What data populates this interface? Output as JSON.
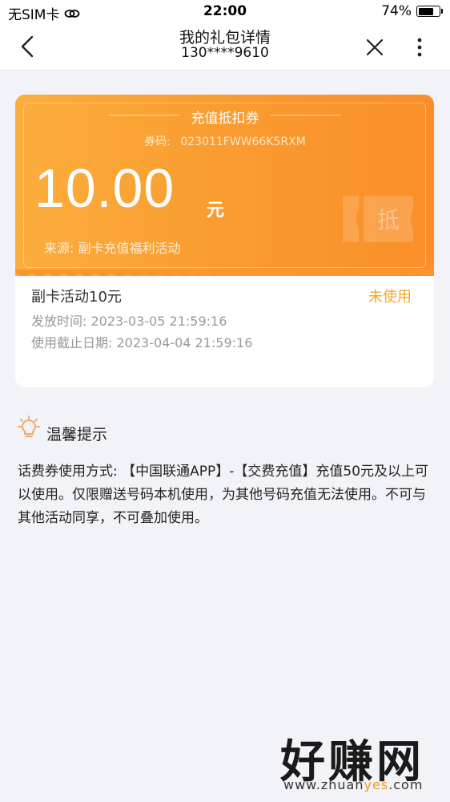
{
  "status_bar": {
    "carrier": "无SIM卡",
    "time": "22:00",
    "battery": "74%",
    "battery_level": 0.74
  },
  "nav": {
    "title": "我的礼包详情",
    "subtitle": "130****9610"
  },
  "coupon": {
    "title": "充值抵扣券",
    "code_label": "券码:",
    "code": "023011FWW66K5RXM",
    "amount": "10.00",
    "unit": "元",
    "source": "来源:  副卡充值福利活动",
    "stamp": "抵",
    "accent": "#fa9a2f"
  },
  "info": {
    "name": "副卡活动10元",
    "status": "未使用",
    "issue_time": "发放时间:  2023-03-05 21:59:16",
    "expire_time": "使用截止日期:  2023-04-04 21:59:16",
    "status_color": "#f5a623"
  },
  "tips": {
    "title": "温馨提示",
    "body": "话费券使用方式: 【中国联通APP】-【交费充值】充值50元及以上可以使用。仅限赠送号码本机使用，为其他号码充值无法使用。不可与其他活动同享，不可叠加使用。",
    "icon": "lightbulb-icon"
  },
  "watermark": {
    "brand": "好赚网",
    "url_prefix": "www.zhuan",
    "url_highlight": "yes",
    "url_suffix": ".com"
  }
}
